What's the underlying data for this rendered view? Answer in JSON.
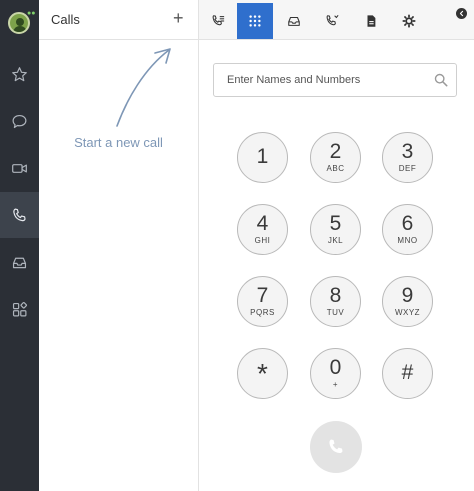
{
  "rail": {
    "items": [
      {
        "icon": "star-icon",
        "active": false
      },
      {
        "icon": "chat-bubble-icon",
        "active": false
      },
      {
        "icon": "video-camera-icon",
        "active": false
      },
      {
        "icon": "phone-icon",
        "active": true
      },
      {
        "icon": "inbox-icon",
        "active": false
      },
      {
        "icon": "apps-grid-icon",
        "active": false
      }
    ]
  },
  "calls_panel": {
    "title": "Calls",
    "add_label": "+",
    "hint": "Start a new call"
  },
  "tabs": [
    {
      "icon": "call-log-icon",
      "active": false
    },
    {
      "icon": "dialpad-icon",
      "active": true
    },
    {
      "icon": "inbox-icon",
      "active": false
    },
    {
      "icon": "voicemail-icon",
      "active": false
    },
    {
      "icon": "fax-icon",
      "active": false
    },
    {
      "icon": "settings-gear-icon",
      "active": false
    }
  ],
  "search": {
    "placeholder": "Enter Names and Numbers",
    "value": ""
  },
  "keypad": [
    {
      "digit": "1",
      "letters": ""
    },
    {
      "digit": "2",
      "letters": "ABC"
    },
    {
      "digit": "3",
      "letters": "DEF"
    },
    {
      "digit": "4",
      "letters": "GHI"
    },
    {
      "digit": "5",
      "letters": "JKL"
    },
    {
      "digit": "6",
      "letters": "MNO"
    },
    {
      "digit": "7",
      "letters": "PQRS"
    },
    {
      "digit": "8",
      "letters": "TUV"
    },
    {
      "digit": "9",
      "letters": "WXYZ"
    },
    {
      "digit": "*",
      "letters": ""
    },
    {
      "digit": "0",
      "letters": "+"
    },
    {
      "digit": "#",
      "letters": ""
    }
  ],
  "colors": {
    "rail_bg": "#2b2f36",
    "accent": "#2f6fcd",
    "hint_text": "#7e97b6"
  }
}
